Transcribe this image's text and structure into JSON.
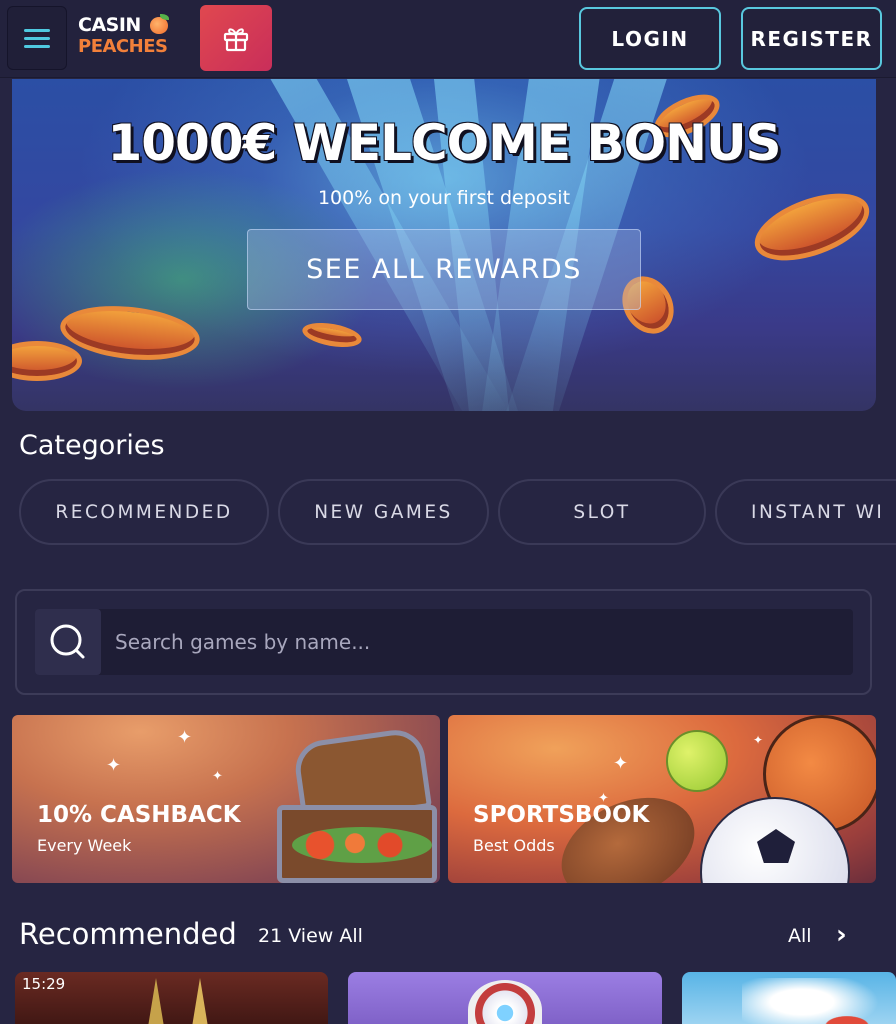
{
  "header": {
    "menu_icon": "hamburger-menu-icon",
    "logo_line1": "CASIN",
    "logo_line2": "PEACHES",
    "gift_icon": "gift-icon",
    "login_label": "LOGIN",
    "register_label": "REGISTER",
    "accent_color": "#59c8de"
  },
  "hero": {
    "title": "1000€ WELCOME BONUS",
    "subtitle": "100% on your first deposit",
    "cta_label": "SEE ALL REWARDS"
  },
  "categories": {
    "title": "Categories",
    "items": [
      {
        "label": "RECOMMENDED"
      },
      {
        "label": "NEW GAMES"
      },
      {
        "label": "SLOT"
      },
      {
        "label": "INSTANT WI"
      }
    ]
  },
  "search": {
    "icon": "search-icon",
    "placeholder": "Search games by name..."
  },
  "promos": [
    {
      "title": "10% CASHBACK",
      "subtitle": "Every Week"
    },
    {
      "title": "SPORTSBOOK",
      "subtitle": "Best Odds"
    }
  ],
  "recommended": {
    "title": "Recommended",
    "count_label": "21 View All",
    "all_label": "All",
    "chevron_icon": "chevron-right-icon",
    "games": [
      {
        "time": "15:29"
      }
    ]
  }
}
